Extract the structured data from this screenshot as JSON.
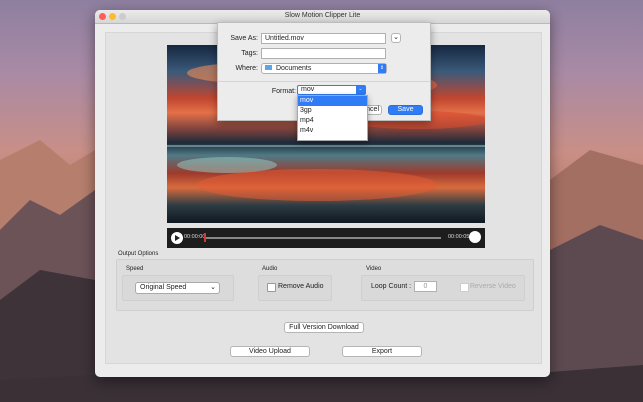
{
  "window": {
    "title": "Slow Motion Clipper Lite"
  },
  "player": {
    "elapsed": "00:00:00",
    "total": "00:00:05"
  },
  "output_options": {
    "label": "Output Options",
    "speed": {
      "label": "Speed",
      "value": "Original Speed"
    },
    "audio": {
      "label": "Audio",
      "remove_label": "Remove Audio"
    },
    "video": {
      "label": "Video",
      "loop_label": "Loop Count :",
      "loop_value": "0",
      "reverse_label": "Reverse Video"
    }
  },
  "buttons": {
    "full_version": "Full Version Download",
    "video_upload": "Video Upload",
    "export": "Export"
  },
  "save_sheet": {
    "save_as_label": "Save As:",
    "save_as_value": "Untitled.mov",
    "tags_label": "Tags:",
    "tags_value": "",
    "where_label": "Where:",
    "where_value": "Documents",
    "format_label": "Format:",
    "format_value": "mov",
    "cancel_label": "ncel",
    "save_label": "Save"
  },
  "format_options": [
    "mov",
    "3gp",
    "mp4",
    "m4v"
  ],
  "colors": {
    "accent": "#2f7cf6",
    "window_bg": "#ececec"
  }
}
